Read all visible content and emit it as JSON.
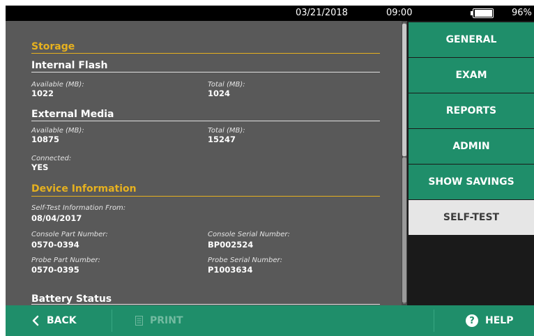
{
  "status": {
    "date": "03/21/2018",
    "time": "09:00",
    "battery_percent": "96%",
    "battery_level": 0.96
  },
  "content": {
    "storage": {
      "title": "Storage",
      "internal": {
        "title": "Internal Flash",
        "available_label": "Available (MB):",
        "available_value": "1022",
        "total_label": "Total (MB):",
        "total_value": "1024"
      },
      "external": {
        "title": "External Media",
        "available_label": "Available (MB):",
        "available_value": "10875",
        "total_label": "Total (MB):",
        "total_value": "15247",
        "connected_label": "Connected:",
        "connected_value": "YES"
      }
    },
    "device": {
      "title": "Device Information",
      "selftest_label": "Self-Test Information From:",
      "selftest_value": "08/04/2017",
      "console_part_label": "Console Part Number:",
      "console_part_value": "0570-0394",
      "console_serial_label": "Console Serial Number:",
      "console_serial_value": "BP002524",
      "probe_part_label": "Probe Part Number:",
      "probe_part_value": "0570-0395",
      "probe_serial_label": "Probe Serial Number:",
      "probe_serial_value": "P1003634"
    },
    "battery": {
      "title": "Battery Status"
    }
  },
  "nav": {
    "items": [
      {
        "label": "GENERAL"
      },
      {
        "label": "EXAM"
      },
      {
        "label": "REPORTS"
      },
      {
        "label": "ADMIN"
      },
      {
        "label": "SHOW SAVINGS"
      },
      {
        "label": "SELF-TEST"
      }
    ],
    "active": "SELF-TEST"
  },
  "bottom": {
    "back_label": "BACK",
    "print_label": "PRINT",
    "help_label": "HELP",
    "help_symbol": "?"
  },
  "colors": {
    "accent": "#1f8e6a",
    "section_heading": "#e6b11f",
    "panel": "#595959"
  },
  "icons": [
    "battery-icon",
    "back-chevron-icon",
    "print-icon",
    "help-icon"
  ]
}
